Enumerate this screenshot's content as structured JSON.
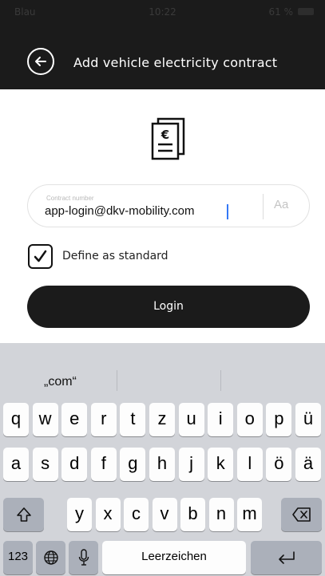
{
  "status_bar": {
    "carrier": "Blau",
    "time": "10:22",
    "battery": "61 %"
  },
  "header": {
    "title": "Add vehicle electricity contract"
  },
  "icons": {
    "back": "back-arrow-icon",
    "contract": "euro-document-icon"
  },
  "contract_field": {
    "label": "Contract number",
    "value": "app-login@dkv-mobility.com",
    "case_toggle": "Aa"
  },
  "standard_checkbox": {
    "label": "Define as standard",
    "checked": true
  },
  "login_button": {
    "label": "Login"
  },
  "keyboard": {
    "suggestion": "„com“",
    "row1": [
      "q",
      "w",
      "e",
      "r",
      "t",
      "z",
      "u",
      "i",
      "o",
      "p",
      "ü"
    ],
    "row2": [
      "a",
      "s",
      "d",
      "f",
      "g",
      "h",
      "j",
      "k",
      "l",
      "ö",
      "ä"
    ],
    "row3": [
      "y",
      "x",
      "c",
      "v",
      "b",
      "n",
      "m"
    ],
    "numbers_key": "123",
    "space_key": "Leerzeichen"
  },
  "colors": {
    "dark": "#1b1b1b",
    "keyboard_bg": "#d2d4d9",
    "caret": "#3478f6"
  }
}
